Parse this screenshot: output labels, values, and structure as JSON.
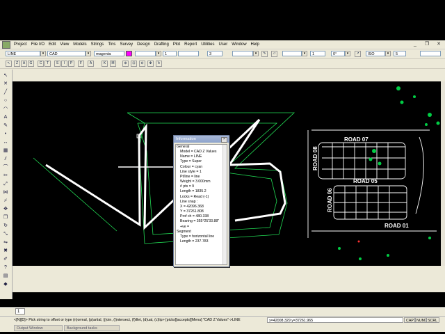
{
  "menu": [
    "Project",
    "File I/O",
    "Edit",
    "View",
    "Models",
    "Strings",
    "Tins",
    "Survey",
    "Design",
    "Drafting",
    "Plot",
    "Report",
    "Utilities",
    "User",
    "Window",
    "Help"
  ],
  "toolbar": {
    "command": "LINE",
    "model": "CAD",
    "colour": "magenta",
    "colour_hex": "#ff00ff",
    "line_style": "1",
    "weight_field": "3",
    "level": "1",
    "angle": "0°",
    "text_style": "ISO",
    "height": "5"
  },
  "snap_buttons": [
    "Z",
    "A",
    "G",
    "C",
    "T",
    "S",
    "I",
    "P",
    "F",
    "A",
    "K",
    "M"
  ],
  "canvas": {
    "labels": [
      "ROAD 07",
      "ROAD 05",
      "ROAD 08",
      "ROAD 06",
      "ROAD 01"
    ],
    "colors": {
      "line": "#ffffff",
      "offset": "#00ff66",
      "green": "#00cc44",
      "red": "#ff3030"
    }
  },
  "info": {
    "title": "Information",
    "lines": [
      {
        "t": "General",
        "k": "hdr"
      },
      {
        "t": "Model = CAD Z Values",
        "k": "ind"
      },
      {
        "t": "Name = LINE",
        "k": "ind"
      },
      {
        "t": "Type = Super",
        "k": "ind"
      },
      {
        "t": "Colour = cyan",
        "k": "ind"
      },
      {
        "t": "Line style = 1",
        "k": "ind"
      },
      {
        "t": "Pt/line = line",
        "k": "ind"
      },
      {
        "t": "Weight = 3.000mm",
        "k": "ind"
      },
      {
        "t": "# pts = 9",
        "k": "ind"
      },
      {
        "t": "Length = 1835.2",
        "k": "ind"
      },
      {
        "t": "Locks = Read (-1)",
        "k": "ind"
      },
      {
        "t": "Line snap :",
        "k": "ind"
      },
      {
        "t": "X = 42096.368",
        "k": "ind"
      },
      {
        "t": "Y = 37261.808",
        "k": "ind"
      },
      {
        "t": "Prof ch = 480.338",
        "k": "ind"
      },
      {
        "t": "Bearing = 355°25'33.88\"",
        "k": "ind"
      },
      {
        "t": "+ve =",
        "k": "ind"
      },
      {
        "t": "Segment",
        "k": "hdr"
      },
      {
        "t": "Type = horizontal line",
        "k": "ind"
      },
      {
        "t": "Length = 237.783",
        "k": "ind"
      }
    ]
  },
  "command_index": "1",
  "status": {
    "message": "<[N][D]> Pick string to offset or type (n)ormal, (p)artial, (j)oin, (i)ntersect, (f)illet, (d)ual, (c)lip> [picks][accepts][Menu] \"CAD Z Values\"->LINE",
    "coords": "x=42008.329 y=37261.965",
    "flags": [
      "CAP",
      "NUM",
      "SCRL"
    ]
  },
  "tasks": [
    "Output Window",
    "Background tasks"
  ]
}
